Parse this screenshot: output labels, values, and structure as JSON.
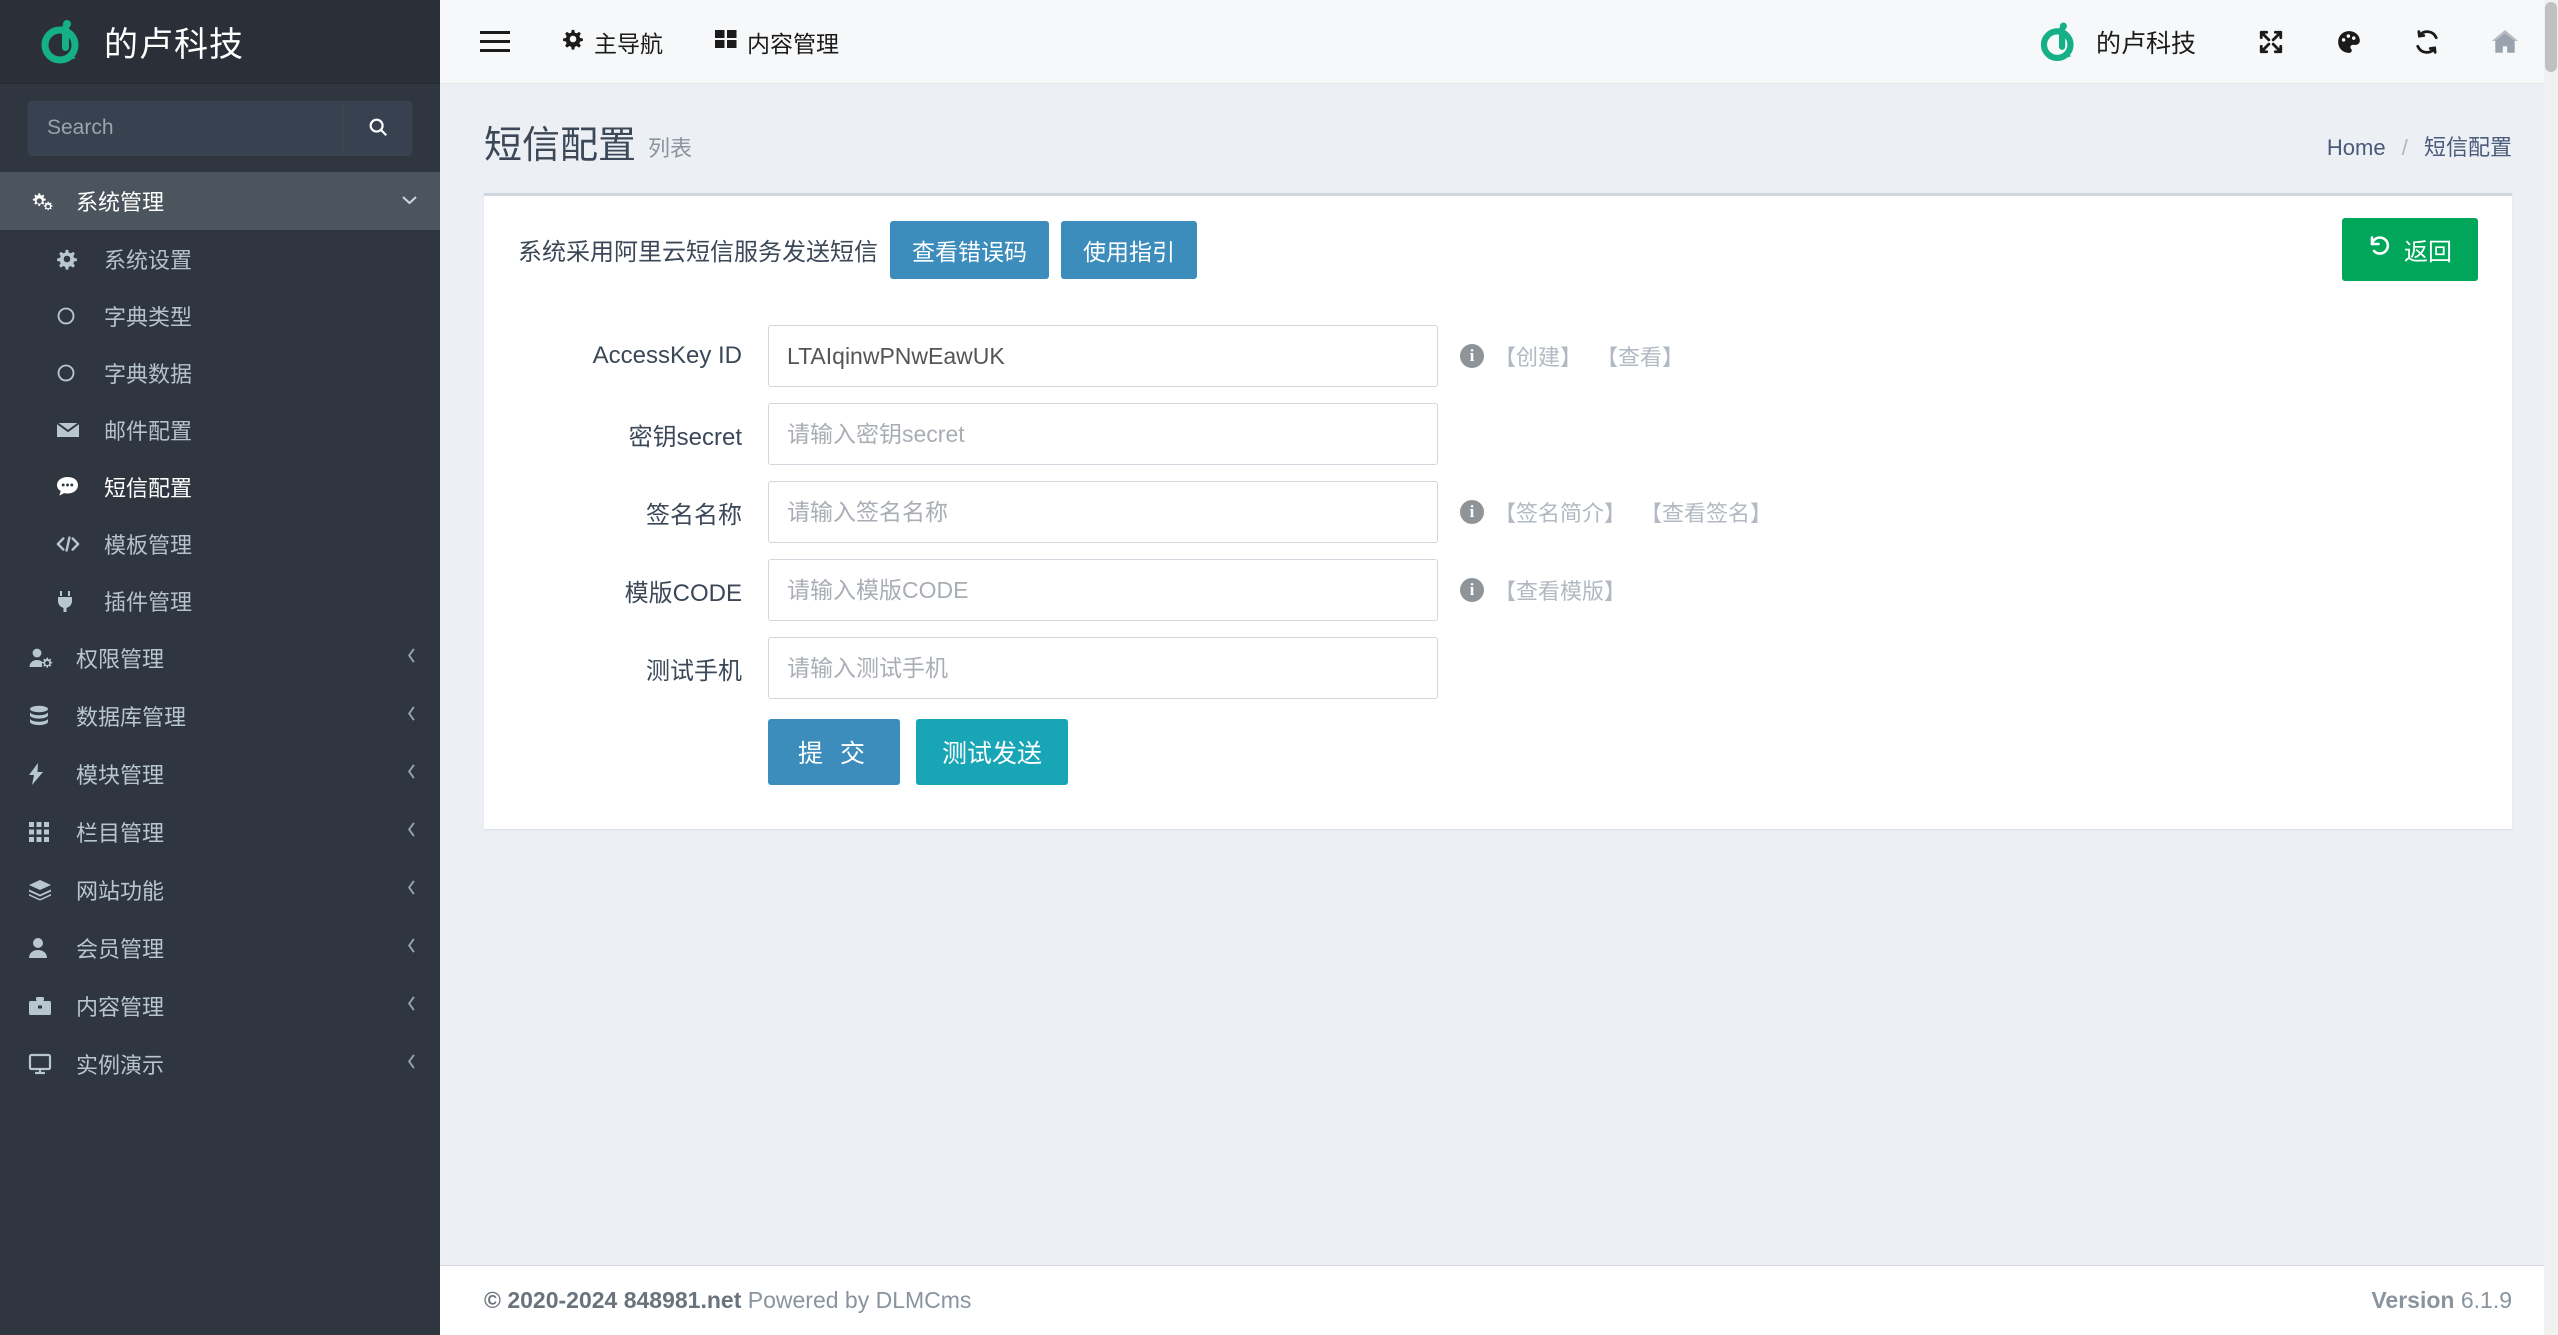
{
  "sidebar": {
    "brand": {
      "title": "的卢科技",
      "logo_icon": "dlu-logo-icon"
    },
    "search": {
      "placeholder": "Search",
      "value": "",
      "icon": "search-icon"
    },
    "items": [
      {
        "label": "系统管理",
        "icon": "cogs-icon",
        "level": "top",
        "active": true,
        "caret": ""
      },
      {
        "label": "系统设置",
        "icon": "gear-icon",
        "level": "sub"
      },
      {
        "label": "字典类型",
        "icon": "circle-o-icon",
        "level": "sub"
      },
      {
        "label": "字典数据",
        "icon": "circle-o-icon",
        "level": "sub"
      },
      {
        "label": "邮件配置",
        "icon": "envelope-icon",
        "level": "sub"
      },
      {
        "label": "短信配置",
        "icon": "comment-dots-icon",
        "level": "sub",
        "selected": true
      },
      {
        "label": "模板管理",
        "icon": "code-icon",
        "level": "sub"
      },
      {
        "label": "插件管理",
        "icon": "plug-icon",
        "level": "sub"
      },
      {
        "label": "权限管理",
        "icon": "user-cog-icon",
        "level": "top",
        "caret": "‹"
      },
      {
        "label": "数据库管理",
        "icon": "database-icon",
        "level": "top",
        "caret": "‹"
      },
      {
        "label": "模块管理",
        "icon": "bolt-icon",
        "level": "top",
        "caret": "‹"
      },
      {
        "label": "栏目管理",
        "icon": "grid-icon",
        "level": "top",
        "caret": "‹"
      },
      {
        "label": "网站功能",
        "icon": "layers-icon",
        "level": "top",
        "caret": "‹"
      },
      {
        "label": "会员管理",
        "icon": "user-icon",
        "level": "top",
        "caret": "‹"
      },
      {
        "label": "内容管理",
        "icon": "briefcase-icon",
        "level": "top",
        "caret": "‹"
      },
      {
        "label": "实例演示",
        "icon": "desktop-icon",
        "level": "top",
        "caret": "‹"
      }
    ]
  },
  "topbar": {
    "menu_toggle_icon": "hamburger-icon",
    "links": [
      {
        "label": "主导航",
        "icon": "gear-icon"
      },
      {
        "label": "内容管理",
        "icon": "th-large-icon"
      }
    ],
    "brand_name": "的卢科技",
    "brand_logo_icon": "dlu-logo-icon",
    "icons": [
      {
        "name": "expand-arrows-icon",
        "glyph": "⤢"
      },
      {
        "name": "palette-icon",
        "glyph": "◕"
      },
      {
        "name": "refresh-icon",
        "glyph": "⟳"
      },
      {
        "name": "home-icon",
        "glyph": "⌂"
      }
    ]
  },
  "page": {
    "title": "短信配置",
    "subtitle": "列表",
    "breadcrumb": {
      "home": "Home",
      "separator": "/",
      "current": "短信配置"
    }
  },
  "card": {
    "notice": "系统采用阿里云短信服务发送短信",
    "error_code_button": "查看错误码",
    "guide_button": "使用指引",
    "back_button": {
      "label": "返回",
      "icon": "undo-icon"
    }
  },
  "form": {
    "fields": [
      {
        "label": "AccessKey ID",
        "name": "accesskey-id",
        "value": "LTAIqinwPNwEawUK",
        "placeholder": "",
        "hint_icon": "info-icon",
        "links": [
          "【创建】",
          "【查看】"
        ]
      },
      {
        "label": "密钥secret",
        "name": "secret-key",
        "value": "",
        "placeholder": "请输入密钥secret",
        "hint_icon": "",
        "links": []
      },
      {
        "label": "签名名称",
        "name": "sign-name",
        "value": "",
        "placeholder": "请输入签名名称",
        "hint_icon": "info-icon",
        "links": [
          "【签名简介】",
          "【查看签名】"
        ]
      },
      {
        "label": "模版CODE",
        "name": "template-code",
        "value": "",
        "placeholder": "请输入模版CODE",
        "hint_icon": "info-icon",
        "links": [
          "【查看模版】"
        ]
      },
      {
        "label": "测试手机",
        "name": "test-phone",
        "value": "",
        "placeholder": "请输入测试手机",
        "hint_icon": "",
        "links": []
      }
    ],
    "submit_label": "提 交",
    "test_send_label": "测试发送"
  },
  "footer": {
    "copyright_strong": "© 2020-2024 848981.net",
    "copyright_rest": " Powered by DLMCms",
    "version_label": "Version",
    "version_value": "6.1.9"
  },
  "colors": {
    "sidebar_bg": "#2f3640",
    "accent_green": "#00a65a",
    "accent_blue": "#3c8dbc",
    "accent_teal": "#18a5b5",
    "logo_green": "#16b086"
  }
}
